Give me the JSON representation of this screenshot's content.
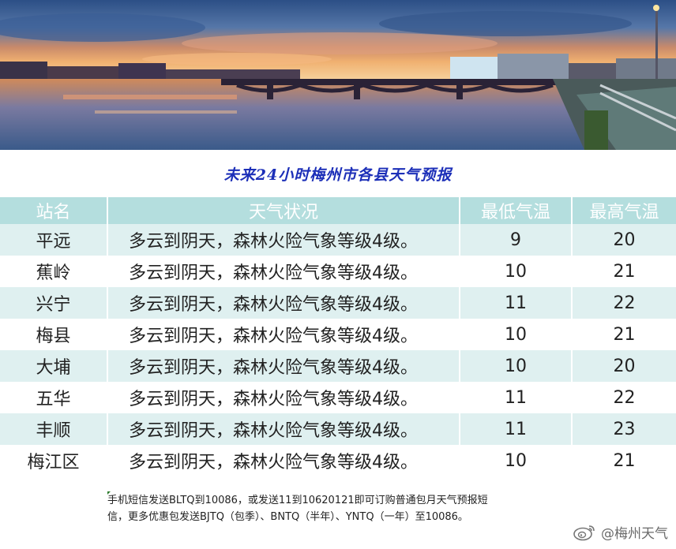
{
  "title": "未来24小时梅州市各县天气预报",
  "table": {
    "headers": [
      "站名",
      "天气状况",
      "最低气温",
      "最高气温"
    ],
    "rows": [
      {
        "station": "平远",
        "weather": "多云到阴天，森林火险气象等级4级。",
        "low": "9",
        "high": "20"
      },
      {
        "station": "蕉岭",
        "weather": "多云到阴天，森林火险气象等级4级。",
        "low": "10",
        "high": "21"
      },
      {
        "station": "兴宁",
        "weather": "多云到阴天，森林火险气象等级4级。",
        "low": "11",
        "high": "22"
      },
      {
        "station": "梅县",
        "weather": "多云到阴天，森林火险气象等级4级。",
        "low": "10",
        "high": "21"
      },
      {
        "station": "大埔",
        "weather": "多云到阴天，森林火险气象等级4级。",
        "low": "10",
        "high": "20"
      },
      {
        "station": "五华",
        "weather": "多云到阴天，森林火险气象等级4级。",
        "low": "11",
        "high": "22"
      },
      {
        "station": "丰顺",
        "weather": "多云到阴天，森林火险气象等级4级。",
        "low": "11",
        "high": "23"
      },
      {
        "station": "梅江区",
        "weather": "多云到阴天，森林火险气象等级4级。",
        "low": "10",
        "high": "21"
      }
    ]
  },
  "footer": {
    "line1": "手机短信发送BLTQ到10086，或发送11到10620121即可订购普通包月天气预报短",
    "line2": "信，更多优惠包发送BJTQ（包季）、BNTQ（半年）、YNTQ（一年）至10086。"
  },
  "watermark": {
    "text": "@梅州天气",
    "icon": "weibo-icon"
  },
  "colors": {
    "title": "#1c2fb8",
    "header_bg": "#b4dede",
    "row_alt_bg": "#dff0f0"
  }
}
